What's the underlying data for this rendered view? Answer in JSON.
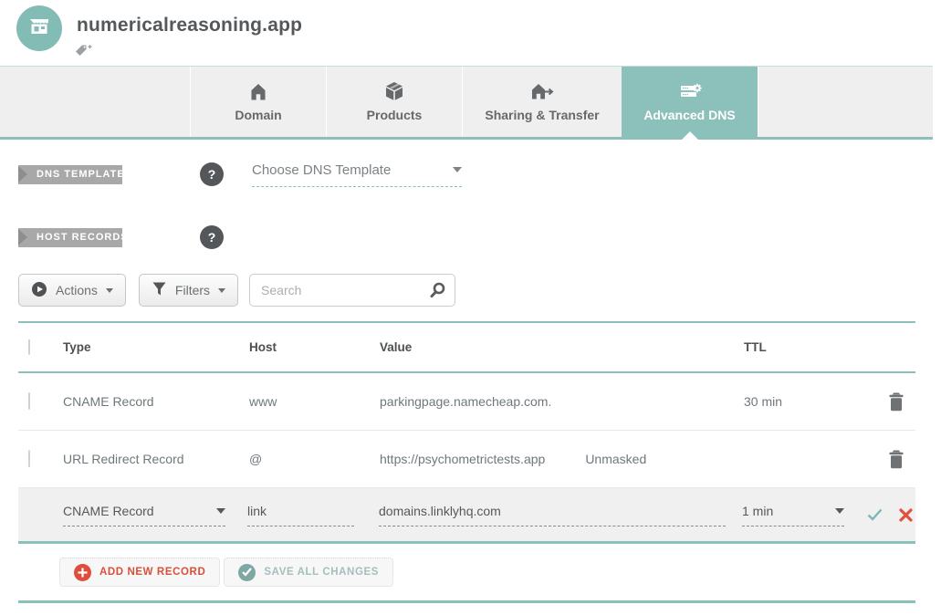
{
  "header": {
    "title": "numericalreasoning.app"
  },
  "tabs": {
    "domain": "Domain",
    "products": "Products",
    "sharing": "Sharing & Transfer",
    "advanced": "Advanced DNS"
  },
  "sections": {
    "dns_templates": {
      "label": "DNS TEMPLATES",
      "help": "?",
      "select_value": "Choose DNS Template"
    },
    "host_records": {
      "label": "HOST RECORDS",
      "help": "?"
    }
  },
  "toolbar": {
    "actions": "Actions",
    "filters": "Filters",
    "search_placeholder": "Search"
  },
  "table": {
    "headers": {
      "type": "Type",
      "host": "Host",
      "value": "Value",
      "ttl": "TTL"
    },
    "rows": [
      {
        "type": "CNAME Record",
        "host": "www",
        "value": "parkingpage.namecheap.com.",
        "value_extra": "",
        "ttl": "30 min"
      },
      {
        "type": "URL Redirect Record",
        "host": "@",
        "value": "https://psychometrictests.app",
        "value_extra": "Unmasked",
        "ttl": ""
      }
    ],
    "edit_row": {
      "type": "CNAME Record",
      "host": "link",
      "value": "domains.linklyhq.com",
      "ttl": "1 min"
    }
  },
  "footer": {
    "add": "ADD NEW RECORD",
    "save": "SAVE ALL CHANGES"
  },
  "colors": {
    "accent_teal": "#8cc0bb",
    "avatar_teal": "#82bcb5",
    "ribbon_gray": "#a8a8a8",
    "help_circle": "#54575a",
    "danger_red": "#dd4f3c",
    "text_gray": "#6e787b",
    "tab_bg": "#efefef"
  }
}
